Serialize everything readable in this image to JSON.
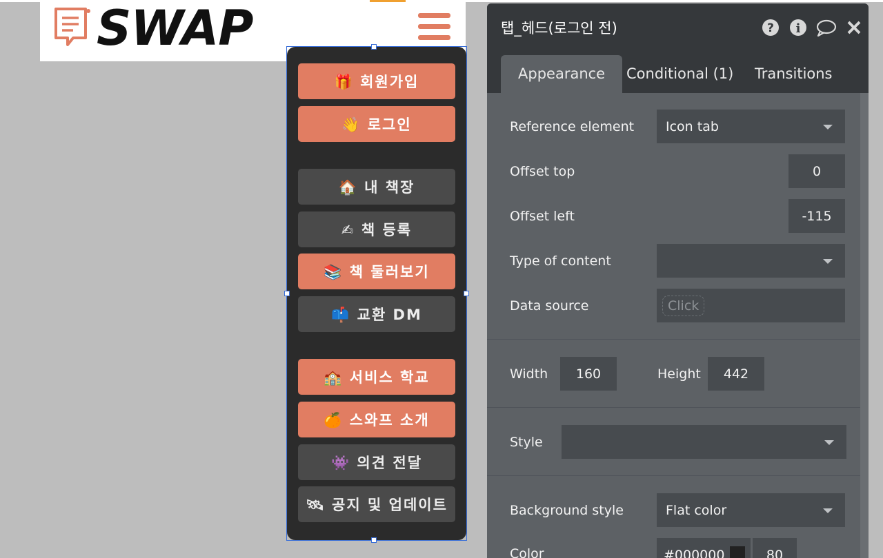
{
  "logo": {
    "text": "SWAP"
  },
  "menu": {
    "items": [
      {
        "label": "🎁 회원가입",
        "style": "orange"
      },
      {
        "label": "👋 로그인",
        "style": "orange"
      },
      {
        "label": "🏠 내 책장",
        "style": "dark"
      },
      {
        "label": "✍ 책 등록",
        "style": "dark"
      },
      {
        "label": "📚 책 둘러보기",
        "style": "orange"
      },
      {
        "label": "📫 교환 DM",
        "style": "dark"
      },
      {
        "label": "🏫 서비스 학교",
        "style": "orange"
      },
      {
        "label": "🍊 스와프 소개",
        "style": "orange"
      },
      {
        "label": "👾 의견 전달",
        "style": "dark"
      },
      {
        "label": "🛰 공지 및 업데이트",
        "style": "dark"
      }
    ]
  },
  "panel": {
    "title": "탭_헤드(로그인 전)",
    "tabs": [
      {
        "label": "Appearance"
      },
      {
        "label": "Conditional (1)"
      },
      {
        "label": "Transitions"
      }
    ],
    "reference_element": {
      "label": "Reference element",
      "value": "Icon tab"
    },
    "offset_top": {
      "label": "Offset top",
      "value": "0"
    },
    "offset_left": {
      "label": "Offset left",
      "value": "-115"
    },
    "type_of_content": {
      "label": "Type of content",
      "value": ""
    },
    "data_source": {
      "label": "Data source",
      "placeholder": "Click"
    },
    "width": {
      "label": "Width",
      "value": "160"
    },
    "height": {
      "label": "Height",
      "value": "442"
    },
    "style": {
      "label": "Style",
      "value": ""
    },
    "background_style": {
      "label": "Background style",
      "value": "Flat color"
    },
    "color": {
      "label": "Color",
      "value": "#000000",
      "opacity": "80"
    }
  },
  "colors": {
    "accent": "#e17d62",
    "menu_bg": "#2b2b2b",
    "menu_dark_button": "#4a4a4a",
    "panel_bg": "#5d6165",
    "panel_header": "#35383b",
    "field_bg": "#474b4f",
    "selection": "#3a6fd8"
  },
  "icons": [
    "chat-logo-icon",
    "hamburger-icon",
    "help-icon",
    "info-icon",
    "comment-icon",
    "close-icon",
    "dropdown-caret-icon"
  ]
}
